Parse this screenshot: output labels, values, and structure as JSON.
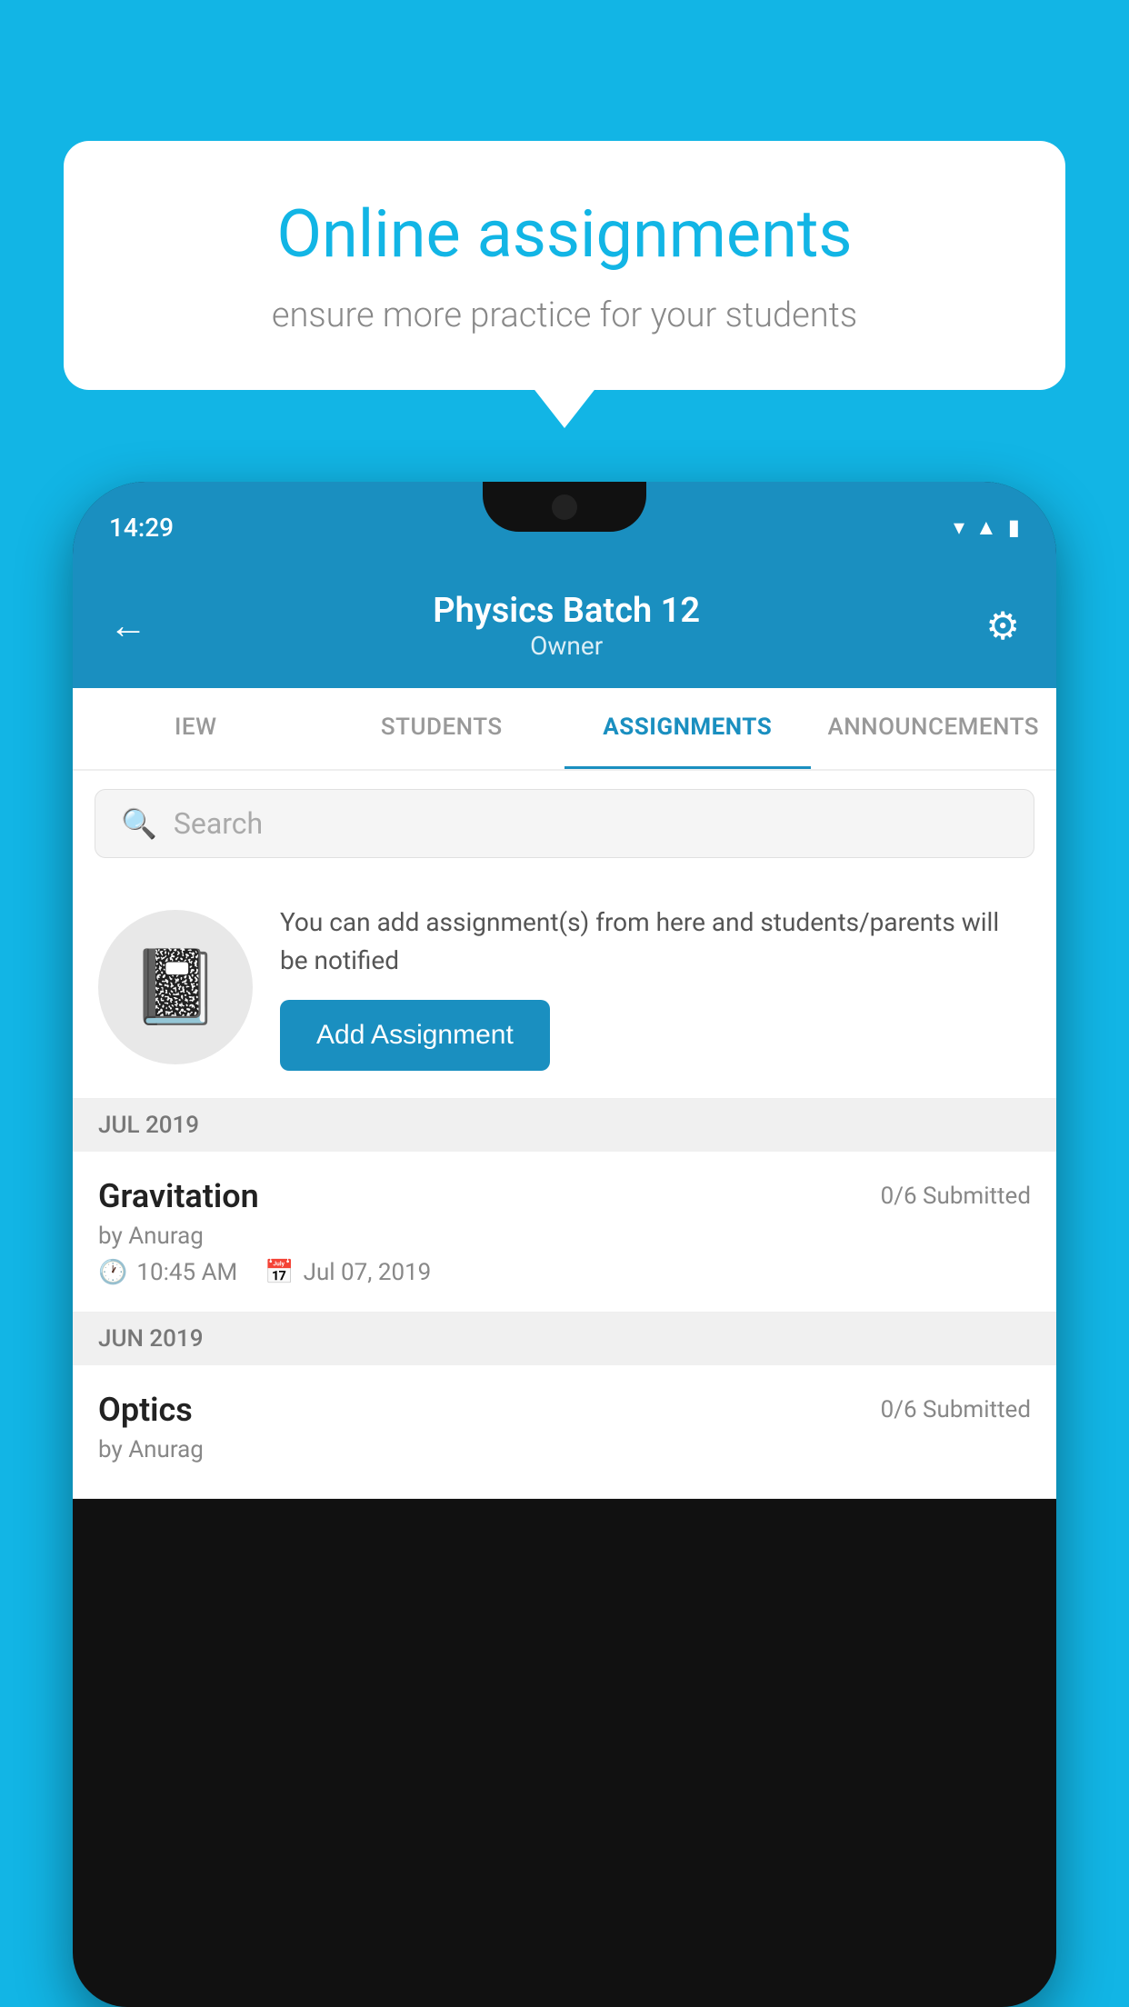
{
  "background_color": "#12b5e5",
  "speech_bubble": {
    "title": "Online assignments",
    "subtitle": "ensure more practice for your students"
  },
  "status_bar": {
    "time": "14:29",
    "icons": [
      "wifi",
      "signal",
      "battery"
    ]
  },
  "header": {
    "title": "Physics Batch 12",
    "subtitle": "Owner"
  },
  "tabs": [
    {
      "label": "IEW",
      "active": false
    },
    {
      "label": "STUDENTS",
      "active": false
    },
    {
      "label": "ASSIGNMENTS",
      "active": true
    },
    {
      "label": "ANNOUNCEMENTS",
      "active": false
    }
  ],
  "search": {
    "placeholder": "Search"
  },
  "info_card": {
    "description": "You can add assignment(s) from here and students/parents will be notified",
    "button_label": "Add Assignment"
  },
  "sections": [
    {
      "header": "JUL 2019",
      "assignments": [
        {
          "name": "Gravitation",
          "submitted": "0/6 Submitted",
          "author": "by Anurag",
          "time": "10:45 AM",
          "date": "Jul 07, 2019"
        }
      ]
    },
    {
      "header": "JUN 2019",
      "assignments": [
        {
          "name": "Optics",
          "submitted": "0/6 Submitted",
          "author": "by Anurag",
          "time": "",
          "date": ""
        }
      ]
    }
  ]
}
